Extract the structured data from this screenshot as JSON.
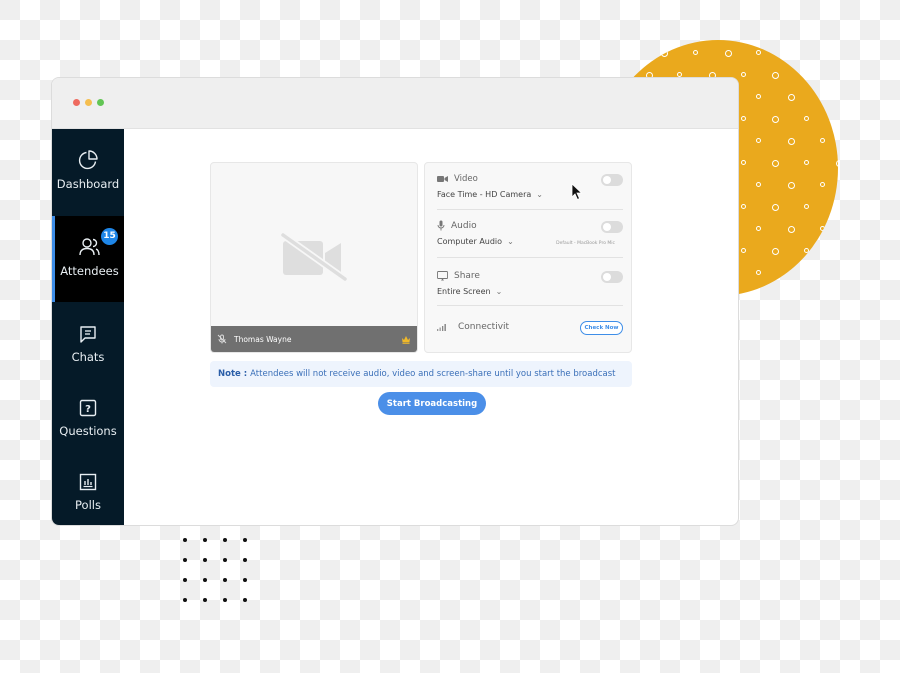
{
  "colors": {
    "accent": "#eaa91d",
    "sidebar_bg": "#051a28",
    "primary_blue": "#4b8fe8",
    "badge_blue": "#1e86e8",
    "traffic_red": "#ee6a5f",
    "traffic_yellow": "#f5be4f",
    "traffic_green": "#62c554"
  },
  "sidebar": {
    "items": [
      {
        "label": "Dashboard",
        "icon": "pie-chart-icon",
        "active": false
      },
      {
        "label": "Attendees",
        "icon": "users-icon",
        "active": true,
        "badge": "15"
      },
      {
        "label": "Chats",
        "icon": "chat-icon",
        "active": false
      },
      {
        "label": "Questions",
        "icon": "question-icon",
        "active": false
      },
      {
        "label": "Polls",
        "icon": "poll-icon",
        "active": false
      }
    ]
  },
  "video_tile": {
    "participant_name": "Thomas Wayne",
    "mic_icon": "mic-off-icon",
    "host_icon": "crown-icon",
    "placeholder_icon": "video-off-icon"
  },
  "settings": {
    "video": {
      "label": "Video",
      "selected": "Face Time - HD Camera",
      "enabled": false
    },
    "audio": {
      "label": "Audio",
      "selected": "Computer Audio",
      "note": "Default - MacBook Pro Mic",
      "enabled": false
    },
    "share": {
      "label": "Share",
      "selected": "Entire Screen",
      "enabled": false
    },
    "connectivity": {
      "label": "Connectivit",
      "button": "Check Now"
    }
  },
  "note": {
    "prefix": "Note :",
    "text": "Attendees will not receive audio, video and screen-share until you start the broadcast"
  },
  "start_button": "Start Broadcasting"
}
